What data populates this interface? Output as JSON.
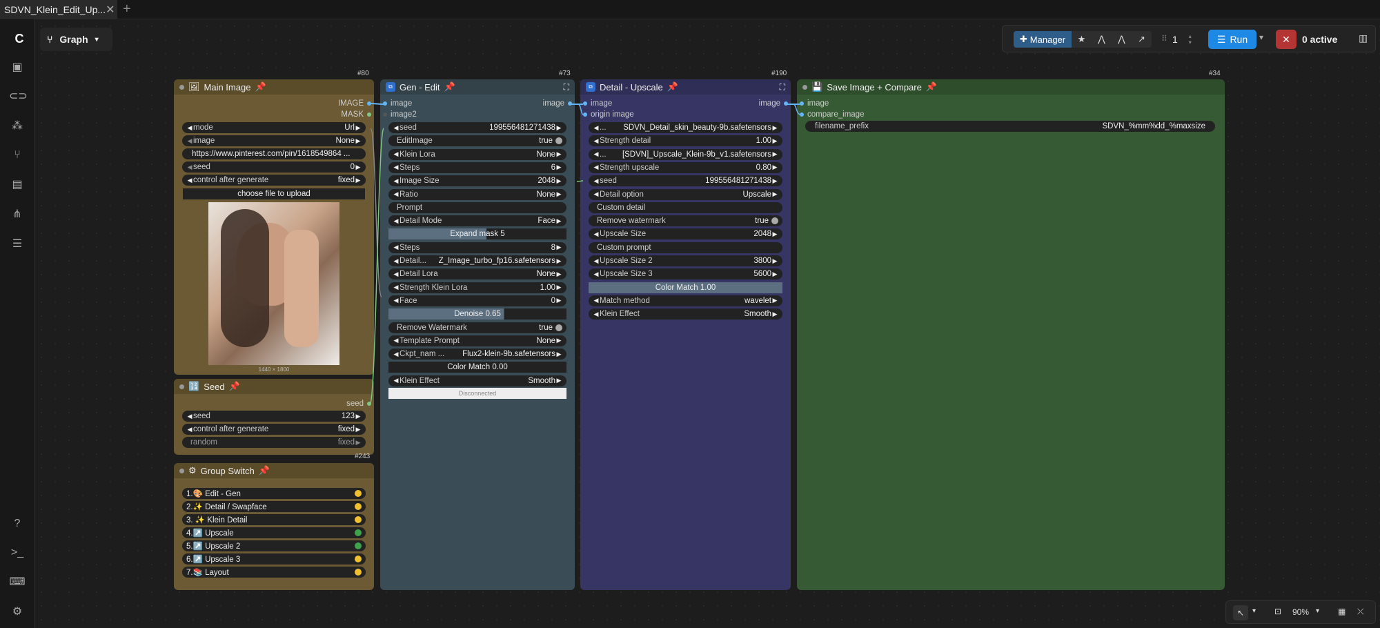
{
  "tab": {
    "title": "SDVN_Klein_Edit_Up...",
    "close": "✕",
    "add": "+"
  },
  "graph_button": {
    "label": "Graph"
  },
  "toolbar": {
    "manager_label": "Manager",
    "queue_count": "1",
    "run_label": "Run",
    "active_label": "0 active"
  },
  "nodes": {
    "main_image": {
      "id": "#80",
      "title": "Main Image",
      "outputs": [
        "IMAGE",
        "MASK"
      ],
      "widgets": [
        {
          "label": "mode",
          "value": "Url"
        },
        {
          "label": "image",
          "value": "None"
        },
        {
          "label": "",
          "value": "https://www.pinterest.com/pin/1618549864 ..."
        },
        {
          "label": "seed",
          "value": "0"
        },
        {
          "label": "control after generate",
          "value": "fixed"
        }
      ],
      "upload_label": "choose file to upload",
      "image_size": "1440 × 1800"
    },
    "seed": {
      "id": "#243",
      "title": "Seed",
      "output": "seed",
      "widgets": [
        {
          "label": "seed",
          "value": "123"
        },
        {
          "label": "control after generate",
          "value": "fixed"
        },
        {
          "label": "random",
          "value": "fixed"
        }
      ]
    },
    "group_switch": {
      "title": "Group Switch",
      "items": [
        {
          "label": "1.🎨  Edit - Gen",
          "color": "#f0c030"
        },
        {
          "label": "2.✨  Detail / Swapface",
          "color": "#f0c030"
        },
        {
          "label": "3. ✨ Klein Detail",
          "color": "#f0c030"
        },
        {
          "label": "4.↗️  Upscale",
          "color": "#3fa34d"
        },
        {
          "label": "5.↗️  Upscale 2",
          "color": "#3fa34d"
        },
        {
          "label": "6.↗️  Upscale 3",
          "color": "#f0c030"
        },
        {
          "label": "7.📚  Layout",
          "color": "#f0c030"
        }
      ]
    },
    "gen_edit": {
      "id": "#73",
      "title": "Gen - Edit",
      "inputs": [
        "image",
        "image2"
      ],
      "output": "image",
      "widgets": [
        {
          "type": "combo",
          "label": "seed",
          "value": "199556481271438"
        },
        {
          "type": "toggle",
          "label": "EditImage",
          "value": "true"
        },
        {
          "type": "combo",
          "label": "Klein Lora",
          "value": "None"
        },
        {
          "type": "combo",
          "label": "Steps",
          "value": "6"
        },
        {
          "type": "combo",
          "label": "Image Size",
          "value": "2048"
        },
        {
          "type": "combo",
          "label": "Ratio",
          "value": "None"
        },
        {
          "type": "text",
          "label": "Prompt",
          "value": ""
        },
        {
          "type": "combo",
          "label": "Detail Mode",
          "value": "Face"
        },
        {
          "type": "slider",
          "label": "Expand mask",
          "value": "5",
          "fill": 0.55
        },
        {
          "type": "combo",
          "label": "Steps",
          "value": "8"
        },
        {
          "type": "combo",
          "label": "Detail...",
          "value": "Z_Image_turbo_fp16.safetensors"
        },
        {
          "type": "combo",
          "label": "Detail Lora",
          "value": "None"
        },
        {
          "type": "combo",
          "label": "Strength Klein Lora",
          "value": "1.00"
        },
        {
          "type": "combo",
          "label": "Face",
          "value": "0"
        },
        {
          "type": "slider",
          "label": "Denoise",
          "value": "0.65",
          "fill": 0.65
        },
        {
          "type": "toggle",
          "label": "Remove Watermark",
          "value": "true"
        },
        {
          "type": "combo",
          "label": "Template Prompt",
          "value": "None"
        },
        {
          "type": "combo",
          "label": "Ckpt_nam ...",
          "value": "Flux2-klein-9b.safetensors"
        },
        {
          "type": "slider",
          "label": "Color Match",
          "value": "0.00",
          "fill": 0.0
        },
        {
          "type": "combo",
          "label": "Klein Effect",
          "value": "Smooth"
        }
      ],
      "status": "Disconnected"
    },
    "detail_upscale": {
      "id": "#190",
      "title": "Detail - Upscale",
      "inputs": [
        "image",
        "origin image"
      ],
      "output": "image",
      "widgets": [
        {
          "type": "combo",
          "label": "...",
          "value": "SDVN_Detail_skin_beauty-9b.safetensors"
        },
        {
          "type": "combo",
          "label": "Strength detail",
          "value": "1.00"
        },
        {
          "type": "combo",
          "label": "...",
          "value": "[SDVN]_Upscale_Klein-9b_v1.safetensors"
        },
        {
          "type": "combo",
          "label": "Strength upscale",
          "value": "0.80"
        },
        {
          "type": "combo",
          "label": "seed",
          "value": "199556481271438"
        },
        {
          "type": "combo",
          "label": "Detail option",
          "value": "Upscale"
        },
        {
          "type": "text",
          "label": "Custom detail",
          "value": ""
        },
        {
          "type": "toggle",
          "label": "Remove watermark",
          "value": "true"
        },
        {
          "type": "combo",
          "label": "Upscale Size",
          "value": "2048"
        },
        {
          "type": "text",
          "label": "Custom prompt",
          "value": ""
        },
        {
          "type": "combo",
          "label": "Upscale Size 2",
          "value": "3800"
        },
        {
          "type": "combo",
          "label": "Upscale Size 3",
          "value": "5600"
        },
        {
          "type": "slider",
          "label": "Color Match",
          "value": "1.00",
          "fill": 1.0
        },
        {
          "type": "combo",
          "label": "Match method",
          "value": "wavelet"
        },
        {
          "type": "combo",
          "label": "Klein Effect",
          "value": "Smooth"
        }
      ]
    },
    "save_compare": {
      "id": "#34",
      "title": "Save Image + Compare",
      "inputs": [
        "image",
        "compare_image"
      ],
      "widget": {
        "label": "filename_prefix",
        "value": "SDVN_%mm%dd_%maxsize"
      }
    }
  },
  "zoom": {
    "level": "90%"
  },
  "colors": {
    "main_image_bg": "#6b5a33",
    "gen_edit_bg": "#3a4c55",
    "detail_bg": "#363564",
    "save_bg": "#365a33",
    "seed_bg": "#6b5a33",
    "accent": "#1e88e5"
  }
}
